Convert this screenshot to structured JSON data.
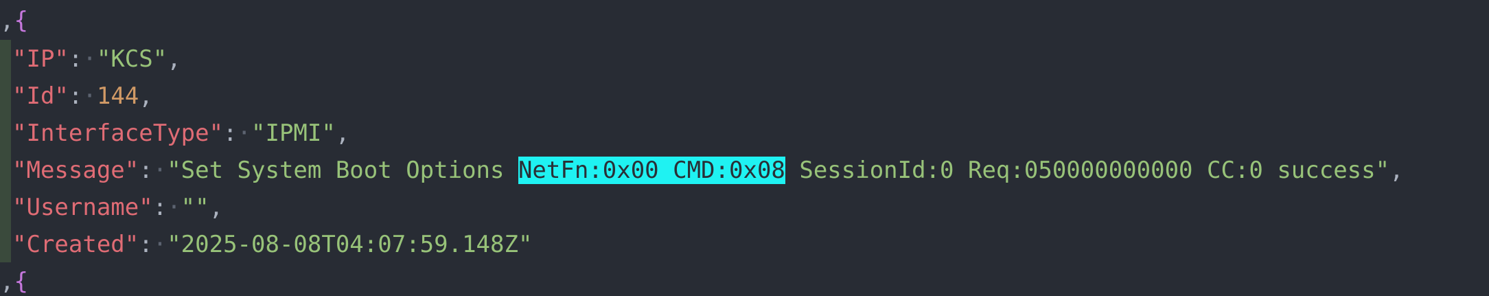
{
  "editor": {
    "open_line": {
      "comma": ",",
      "brace": "{"
    },
    "entries": {
      "ip": {
        "key": "\"IP\"",
        "colon": ":",
        "value": "\"KCS\"",
        "trail": ","
      },
      "id": {
        "key": "\"Id\"",
        "colon": ":",
        "value": "144",
        "trail": ","
      },
      "interface_type": {
        "key": "\"InterfaceType\"",
        "colon": ":",
        "value": "\"IPMI\"",
        "trail": ","
      },
      "message": {
        "key": "\"Message\"",
        "colon": ":",
        "value_before": "\"Set System Boot Options ",
        "value_highlight": "NetFn:0x00 CMD:0x08",
        "value_after": " SessionId:0 Req:050000000000 CC:0 success\"",
        "trail": ","
      },
      "username": {
        "key": "\"Username\"",
        "colon": ":",
        "value": "\"\"",
        "trail": ","
      },
      "created": {
        "key": "\"Created\"",
        "colon": ":",
        "value": "\"2025-08-08T04:07:59.148Z\"",
        "trail": ""
      }
    },
    "close_line": {
      "comma": ",",
      "brace": "{"
    },
    "colors": {
      "background": "#282c34",
      "key": "#e06c75",
      "string": "#98c379",
      "number": "#d19a66",
      "brace": "#c678dd",
      "highlight": "#1ff2f2"
    }
  }
}
